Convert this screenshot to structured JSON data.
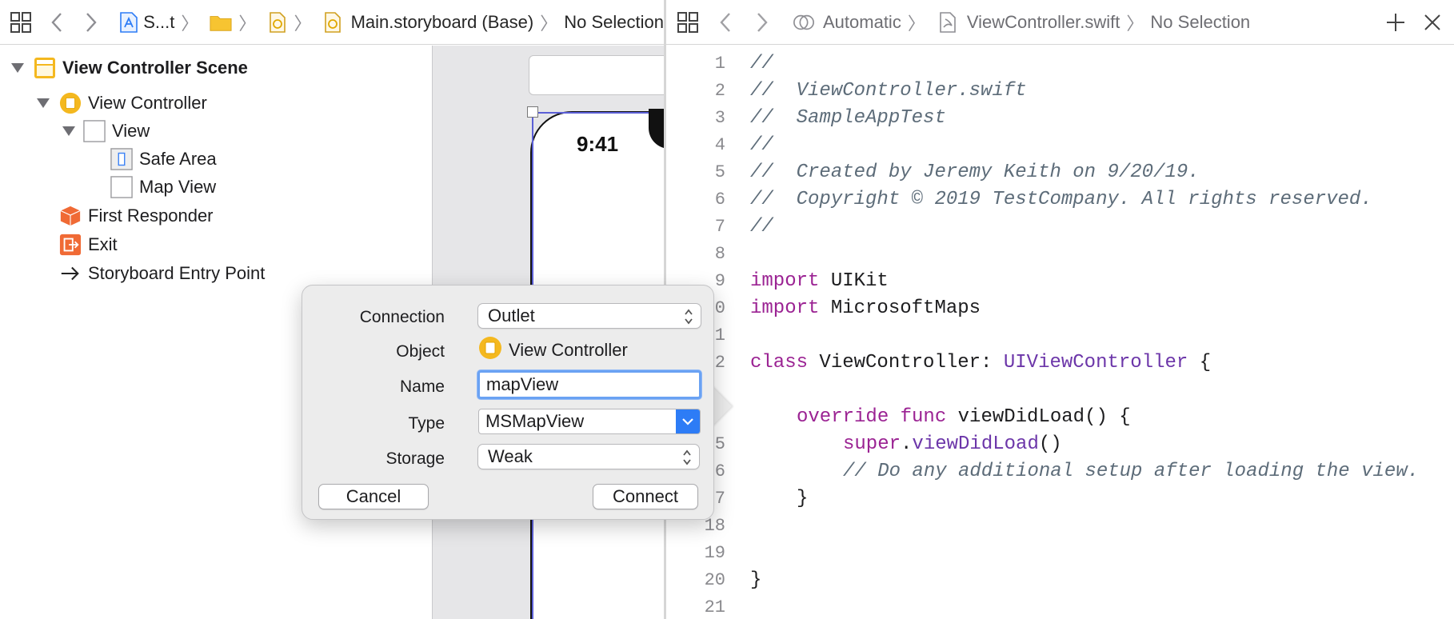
{
  "left_jumpbar": {
    "crumbs": [
      {
        "icon": "app-project-icon",
        "text": "S...t"
      },
      {
        "icon": "folder-icon",
        "text": ""
      },
      {
        "icon": "storyboard-file-icon",
        "text": ""
      },
      {
        "icon": "storyboard-file-icon",
        "text": "Main.storyboard (Base)"
      },
      {
        "icon": "",
        "text": "No Selection"
      }
    ]
  },
  "outline": {
    "scene": "View Controller Scene",
    "view_controller": "View Controller",
    "view": "View",
    "safe_area": "Safe Area",
    "map_view": "Map View",
    "first_responder": "First Responder",
    "exit": "Exit",
    "entry_point": "Storyboard Entry Point"
  },
  "canvas": {
    "status_time": "9:41"
  },
  "right_jumpbar": {
    "mode": "Automatic",
    "file": "ViewController.swift",
    "selection": "No Selection"
  },
  "code": {
    "line_numbers": [
      "1",
      "2",
      "3",
      "4",
      "5",
      "6",
      "7",
      "8",
      "9",
      "0",
      "1",
      "2",
      "",
      "",
      "5",
      "6",
      "7",
      "18",
      "19",
      "20",
      "21"
    ],
    "lines": [
      "//",
      "//  ViewController.swift",
      "//  SampleAppTest",
      "//",
      "//  Created by Jeremy Keith on 9/20/19.",
      "//  Copyright © 2019 TestCompany. All rights reserved.",
      "//",
      "",
      "import",
      "import",
      "",
      "class",
      "",
      "override",
      "super",
      "// Do any additional setup after loading the view.",
      "}",
      "",
      "",
      "}",
      ""
    ],
    "tokens": {
      "import_uikit": " UIKit",
      "import_maps": " MicrosoftMaps",
      "class_name": " ViewController: ",
      "superclass": "UIViewController",
      "brace_open": " {",
      "func_kw": " func",
      "func_rest": " viewDidLoad() {",
      "dot": ".",
      "super_call": "viewDidLoad",
      "parens": "()"
    }
  },
  "popover": {
    "connection_label": "Connection",
    "connection_value": "Outlet",
    "object_label": "Object",
    "object_value": "View Controller",
    "name_label": "Name",
    "name_value": "mapView",
    "type_label": "Type",
    "type_value": "MSMapView",
    "storage_label": "Storage",
    "storage_value": "Weak",
    "cancel": "Cancel",
    "connect": "Connect"
  }
}
